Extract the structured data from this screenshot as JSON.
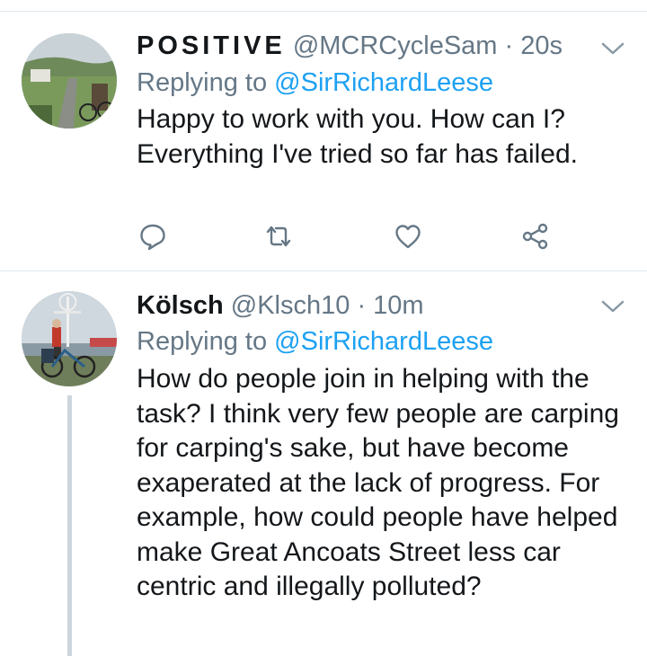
{
  "tweets": [
    {
      "display_name": "POSITIVE",
      "handle": "@MCRCycleSam",
      "separator": "·",
      "time": "20s",
      "replying_label": "Replying to",
      "replying_to": "@SirRichardLeese",
      "text": "Happy to work with you. How can I?\nEverything I've tried so far has failed.",
      "actions": [
        "reply-icon",
        "retweet-icon",
        "like-icon",
        "share-icon"
      ]
    },
    {
      "display_name": "Kölsch",
      "handle": "@Klsch10",
      "separator": "·",
      "time": "10m",
      "replying_label": "Replying to",
      "replying_to": "@SirRichardLeese",
      "text": "How do people join in helping with the\ntask? I think very few people are carping\nfor carping's sake, but have become\nexaperated at the lack of progress. For\nexample, how could people have helped\nmake Great Ancoats Street less car\ncentric and illegally polluted?"
    }
  ],
  "colors": {
    "text": "#14171a",
    "secondary": "#657786",
    "link": "#1da1f2",
    "divider": "#e1e8ed",
    "thread_line": "#ccd6dd"
  }
}
